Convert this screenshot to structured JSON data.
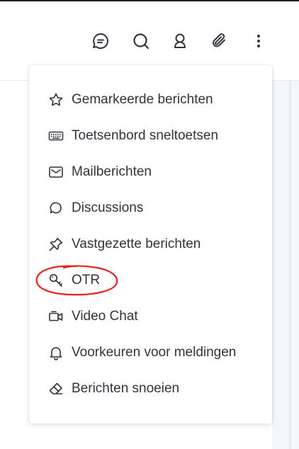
{
  "colors": {
    "text": "#2f343d",
    "icon": "#2f343d",
    "annotation": "#e8221f"
  },
  "toolbar": {
    "buttons": [
      {
        "icon": "chat-bubble-icon"
      },
      {
        "icon": "search-icon"
      },
      {
        "icon": "user-icon"
      },
      {
        "icon": "paperclip-icon"
      },
      {
        "icon": "kebab-menu-icon"
      }
    ]
  },
  "menu": {
    "items": [
      {
        "label": "Gemarkeerde berichten",
        "icon": "star-icon"
      },
      {
        "label": "Toetsenbord sneltoetsen",
        "icon": "keyboard-icon"
      },
      {
        "label": "Mailberichten",
        "icon": "mail-icon"
      },
      {
        "label": "Discussions",
        "icon": "discussion-icon"
      },
      {
        "label": "Vastgezette berichten",
        "icon": "pin-icon"
      },
      {
        "label": "OTR",
        "icon": "key-icon"
      },
      {
        "label": "Video Chat",
        "icon": "video-icon"
      },
      {
        "label": "Voorkeuren voor meldingen",
        "icon": "bell-icon"
      },
      {
        "label": "Berichten snoeien",
        "icon": "eraser-icon"
      }
    ]
  }
}
